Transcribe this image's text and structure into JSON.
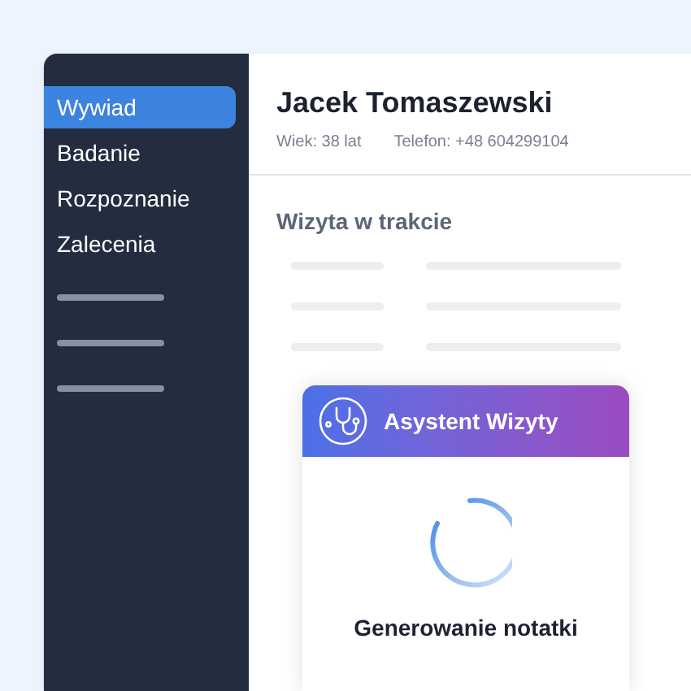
{
  "sidebar": {
    "items": [
      {
        "label": "Wywiad",
        "selected": true
      },
      {
        "label": "Badanie",
        "selected": false
      },
      {
        "label": "Rozpoznanie",
        "selected": false
      },
      {
        "label": "Zalecenia",
        "selected": false
      }
    ]
  },
  "patient": {
    "name": "Jacek Tomaszewski",
    "age": "Wiek: 38 lat",
    "phone": "Telefon: +48 604299104"
  },
  "visit": {
    "title": "Wizyta w trakcie"
  },
  "assistant": {
    "title": "Asystent Wizyty",
    "status": "Generowanie notatki"
  }
}
